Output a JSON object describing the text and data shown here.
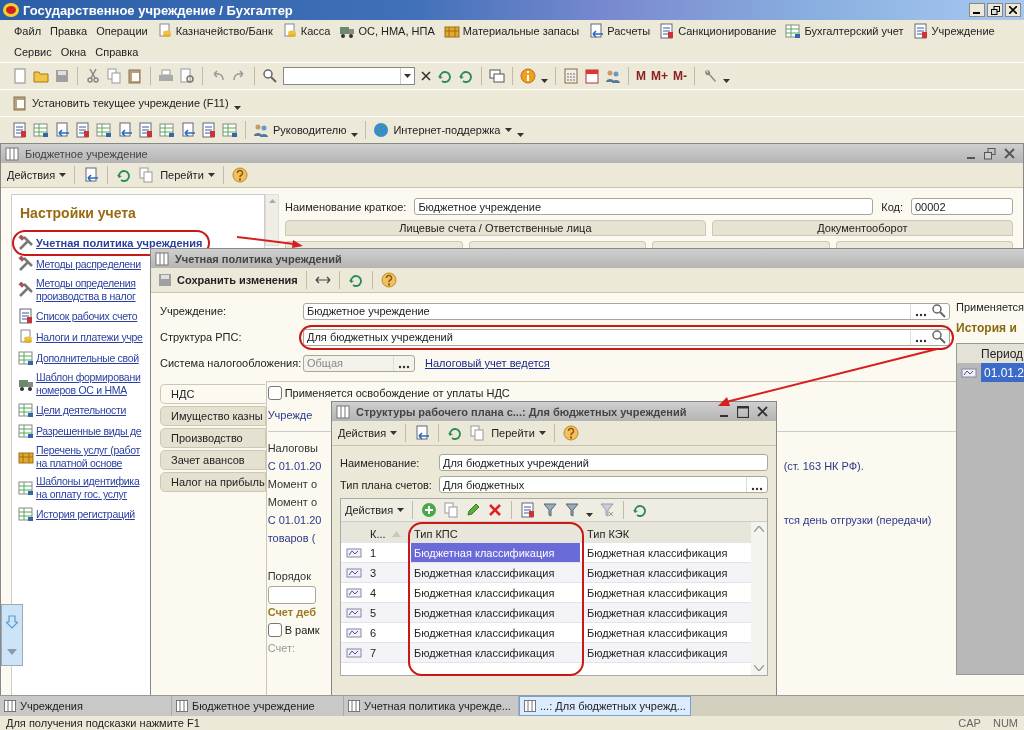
{
  "window": {
    "title": "Государственное учреждение / Бухгалтер"
  },
  "menu_rows": [
    [
      "Файл",
      "Правка",
      "Операции",
      "Казначейство/Банк",
      "Касса",
      "ОС, НМА, НПА",
      "Материальные запасы",
      "Расчеты",
      "Санкционирование",
      "Бухгалтерский учет",
      "Учреждение"
    ],
    [
      "Сервис",
      "Окна",
      "Справка"
    ]
  ],
  "memory_buttons": [
    "M",
    "M+",
    "M-"
  ],
  "institution_button": "Установить текущее учреждение (F11)",
  "report_buttons": [
    "Руководителю",
    "Интернет-поддержка"
  ],
  "institution_window": {
    "title": "Бюджетное учреждение",
    "toolbar": [
      "Действия",
      "Перейти"
    ],
    "settings_heading": "Настройки учета",
    "links": [
      {
        "lines": [
          "Учетная политика учреждения"
        ],
        "selected": true
      },
      {
        "lines": [
          "Методы распределени"
        ],
        "selected": false
      },
      {
        "lines": [
          "Методы определения",
          "производства в налог"
        ],
        "selected": false
      },
      {
        "lines": [
          "Список рабочих счето"
        ],
        "selected": false
      },
      {
        "lines": [
          "Налоги и платежи учре"
        ],
        "selected": false
      },
      {
        "lines": [
          "Дополнительные свой"
        ],
        "selected": false
      },
      {
        "lines": [
          "Шаблон формировани",
          "номеров ОС и НМА"
        ],
        "selected": false
      },
      {
        "lines": [
          "Цели деятельности"
        ],
        "selected": false
      },
      {
        "lines": [
          "Разрешенные виды де"
        ],
        "selected": false
      },
      {
        "lines": [
          "Перечень услуг (работ",
          "на платной основе"
        ],
        "selected": false
      },
      {
        "lines": [
          "Шаблоны идентифика",
          "на оплату гос. услуг"
        ],
        "selected": false
      },
      {
        "lines": [
          "История регистраций"
        ],
        "selected": false
      }
    ],
    "short_name_label": "Наименование краткое:",
    "short_name": "Бюджетное учреждение",
    "code_label": "Код:",
    "code": "00002",
    "tabs": [
      "Лицевые счета / Ответственные лица",
      "Документооборот"
    ]
  },
  "policy_window": {
    "title": "Учетная политика учреждений",
    "save_button": "Сохранить изменения",
    "fields": [
      {
        "label": "Учреждение:",
        "value": "Бюджетное учреждение"
      },
      {
        "label": "Структура РПС:",
        "value": "Для бюджетных учреждений"
      }
    ],
    "tax_system": {
      "label": "Система налогообложения:",
      "value": "Общая",
      "disabled": true
    },
    "tax_link": "Налоговый учет ведется",
    "applies_label": "Применяется",
    "history_heading": "История и",
    "history_column": "Период",
    "history_rows": [
      {
        "period": "01.01.2",
        "selected": true
      }
    ],
    "side_tabs": [
      {
        "label": "НДС",
        "selected": true
      },
      {
        "label": "Имущество казны",
        "selected": false
      },
      {
        "label": "Производство",
        "selected": false
      },
      {
        "label": "Зачет авансов",
        "selected": false
      },
      {
        "label": "Налог на прибыль",
        "selected": false
      }
    ],
    "vat_rows": [
      {
        "kind": "checkbox",
        "label": "Применяется освобождение от уплаты НДС",
        "checked": false
      },
      {
        "kind": "note",
        "left": "Учрежде"
      },
      {
        "kind": "label",
        "left": "Налоговы"
      },
      {
        "kind": "note",
        "left": "С 01.01.20",
        "right": "(ст. 163 НК РФ)."
      },
      {
        "kind": "label",
        "left": "Момент о"
      },
      {
        "kind": "label",
        "left": "Момент о"
      },
      {
        "kind": "note",
        "left": "С 01.01.20",
        "right": "тся день отгрузки (передачи)"
      },
      {
        "kind": "note",
        "left": "товаров ("
      },
      {
        "kind": "label",
        "left": "Порядок"
      },
      {
        "kind": "field"
      },
      {
        "kind": "heading",
        "left": "Счет деб"
      },
      {
        "kind": "checkbox",
        "label": "В рамк",
        "checked": false
      },
      {
        "kind": "muted",
        "left": "Счет:"
      }
    ]
  },
  "structure_window": {
    "title": "Структуры рабочего плана с...: Для бюджетных учреждений",
    "toolbar": [
      "Действия",
      "Перейти"
    ],
    "name_label": "Наименование:",
    "name": "Для бюджетных учреждений",
    "chart_type_label": "Тип плана счетов:",
    "chart_type": "Для бюджетных",
    "table_actions": "Действия",
    "columns": [
      "К...",
      "Тип КПС",
      "Тип КЭК"
    ],
    "rows": [
      {
        "code": "1",
        "kps": "Бюджетная классификация",
        "kek": "Бюджетная классификация",
        "selected": true
      },
      {
        "code": "3",
        "kps": "Бюджетная классификация",
        "kek": "Бюджетная классификация",
        "selected": false
      },
      {
        "code": "4",
        "kps": "Бюджетная классификация",
        "kek": "Бюджетная классификация",
        "selected": false
      },
      {
        "code": "5",
        "kps": "Бюджетная классификация",
        "kek": "Бюджетная классификация",
        "selected": false
      },
      {
        "code": "6",
        "kps": "Бюджетная классификация",
        "kek": "Бюджетная классификация",
        "selected": false
      },
      {
        "code": "7",
        "kps": "Бюджетная классификация",
        "kek": "Бюджетная классификация",
        "selected": false
      }
    ]
  },
  "taskbar": [
    {
      "label": "Учреждения",
      "selected": false
    },
    {
      "label": "Бюджетное учреждение",
      "selected": false
    },
    {
      "label": "Учетная политика учрежде...",
      "selected": false
    },
    {
      "label": "...: Для бюджетных учрежд...",
      "selected": true
    }
  ],
  "status_bar": {
    "hint": "Для получения подсказки нажмите F1",
    "indicators": [
      "CAP",
      "NUM"
    ]
  }
}
